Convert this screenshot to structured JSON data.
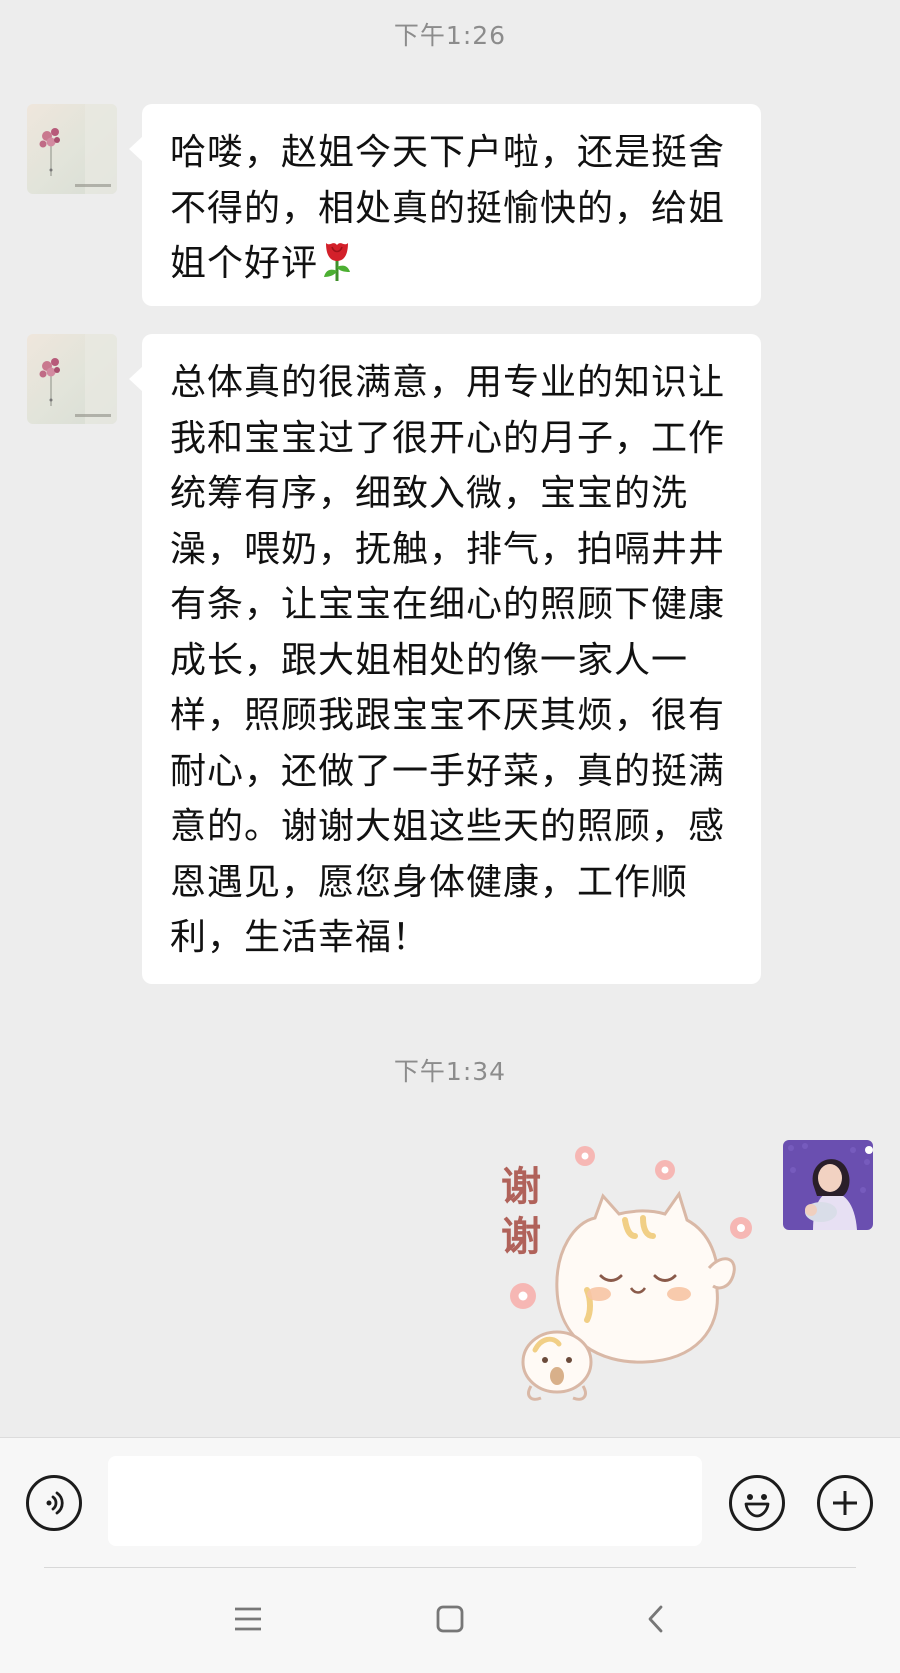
{
  "chat": {
    "messages": [
      {
        "kind": "timestamp",
        "text": "下午1:26"
      },
      {
        "kind": "text",
        "side": "left",
        "text": "哈喽，赵姐今天下户啦，还是挺舍不得的，相处真的挺愉快的，给姐姐个好评",
        "emoji": "rose-emoji"
      },
      {
        "kind": "text",
        "side": "left",
        "text": "总体真的很满意，用专业的知识让我和宝宝过了很开心的月子，工作统筹有序，细致入微，宝宝的洗澡，喂奶，抚触，排气，拍嗝井井有条，让宝宝在细心的照顾下健康成长，跟大姐相处的像一家人一样，照顾我跟宝宝不厌其烦，很有耐心，还做了一手好菜，真的挺满意的。谢谢大姐这些天的照顾，感恩遇见，愿您身体健康，工作顺利，生活幸福！"
      },
      {
        "kind": "timestamp",
        "text": "下午1:34"
      },
      {
        "kind": "sticker",
        "side": "right",
        "sticker_text": "谢谢"
      }
    ]
  },
  "input_bar": {
    "voice_icon": "voice-icon",
    "emoji_icon": "emoji-smile-icon",
    "more_icon": "plus-icon",
    "input_value": ""
  },
  "nav": {
    "menu_icon": "menu-icon",
    "home_icon": "square-home-icon",
    "back_icon": "back-chevron-icon"
  },
  "colors": {
    "background": "#ededed",
    "bubble": "#ffffff",
    "timestamp_text": "#8c8c8c",
    "sticker_text": "#b0625a"
  }
}
